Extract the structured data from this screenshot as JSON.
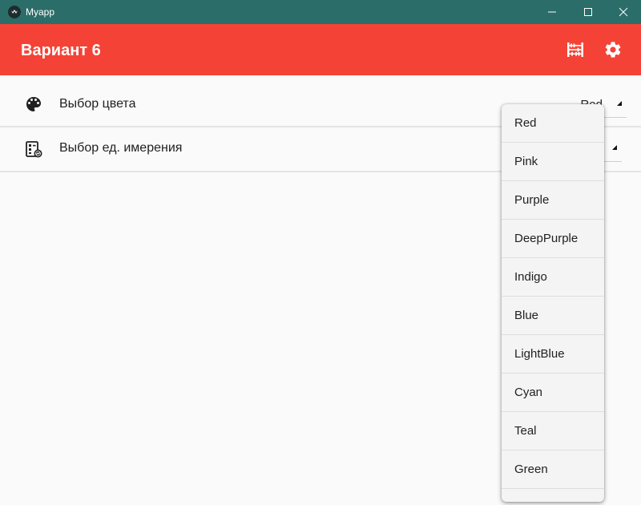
{
  "window": {
    "title": "Myapp",
    "controls": {
      "minimize_icon": "minimize-icon",
      "maximize_icon": "maximize-icon",
      "close_icon": "close-icon"
    },
    "titlebar_color": "#2b6d69"
  },
  "appbar": {
    "title": "Вариант 6",
    "color": "#f44336",
    "actions": [
      {
        "icon": "abacus-icon"
      },
      {
        "icon": "gear-icon"
      }
    ]
  },
  "settings": {
    "color_row": {
      "icon": "palette-icon",
      "label": "Выбор цвета",
      "value": "Red"
    },
    "unit_row": {
      "icon": "unit-settings-icon",
      "label": "Выбор ед. имерения",
      "value": ""
    }
  },
  "menu": {
    "items": [
      "Red",
      "Pink",
      "Purple",
      "DeepPurple",
      "Indigo",
      "Blue",
      "LightBlue",
      "Cyan",
      "Teal",
      "Green",
      ""
    ]
  }
}
